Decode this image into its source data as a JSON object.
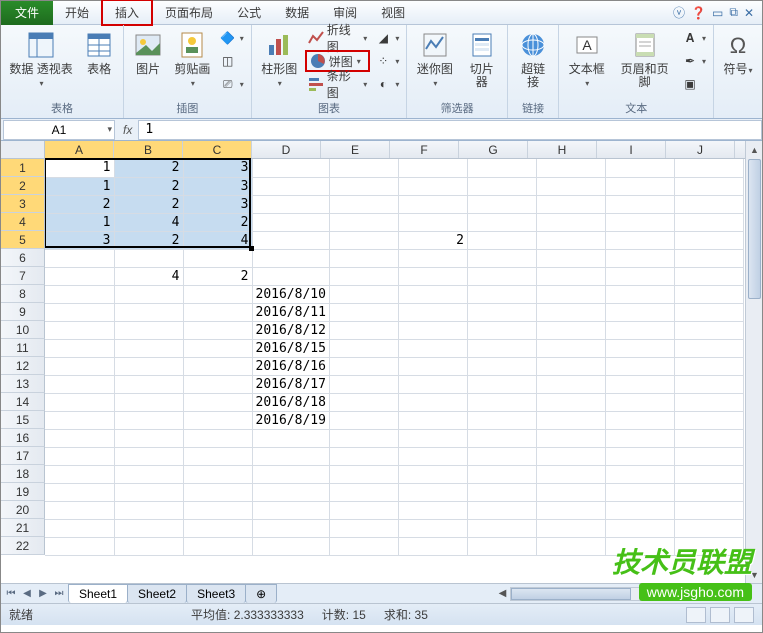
{
  "menu": {
    "file": "文件",
    "tabs": [
      "开始",
      "插入",
      "页面布局",
      "公式",
      "数据",
      "审阅",
      "视图"
    ],
    "active_index": 1
  },
  "ribbon": {
    "groups": {
      "tables": {
        "label": "表格",
        "pivot": "数据\n透视表",
        "table": "表格"
      },
      "illustrations": {
        "label": "插图",
        "picture": "图片",
        "clipart": "剪贴画"
      },
      "charts": {
        "label": "图表",
        "column": "柱形图",
        "line": "折线图",
        "pie": "饼图",
        "bar": "条形图"
      },
      "sparklines": {
        "label": "筛选器",
        "spark": "迷你图",
        "slicer": "切片器"
      },
      "links": {
        "label": "链接",
        "hyper": "超链接"
      },
      "text": {
        "label": "文本",
        "textbox": "文本框",
        "headerfooter": "页眉和页脚"
      },
      "symbols": {
        "label": "",
        "symbol": "符号"
      }
    }
  },
  "formula_bar": {
    "name_box": "A1",
    "fx": "fx",
    "value": "1"
  },
  "columns": [
    "A",
    "B",
    "C",
    "D",
    "E",
    "F",
    "G",
    "H",
    "I",
    "J"
  ],
  "rows_visible": 22,
  "selection": {
    "rows": [
      1,
      2,
      3,
      4,
      5
    ],
    "cols": [
      "A",
      "B",
      "C"
    ]
  },
  "cells": {
    "A1": "1",
    "B1": "2",
    "C1": "3",
    "A2": "1",
    "B2": "2",
    "C2": "3",
    "A3": "2",
    "B3": "2",
    "C3": "3",
    "A4": "1",
    "B4": "4",
    "C4": "2",
    "A5": "3",
    "B5": "2",
    "C5": "4",
    "F5": "2",
    "B7": "4",
    "C7": "2",
    "D8": "2016/8/10",
    "D9": "2016/8/11",
    "D10": "2016/8/12",
    "D11": "2016/8/15",
    "D12": "2016/8/16",
    "D13": "2016/8/17",
    "D14": "2016/8/18",
    "D15": "2016/8/19"
  },
  "sheet_tabs": [
    "Sheet1",
    "Sheet2",
    "Sheet3"
  ],
  "status": {
    "ready": "就绪",
    "avg_label": "平均值:",
    "avg": "2.333333333",
    "count_label": "计数:",
    "count": "15",
    "sum_label": "求和:",
    "sum": "35"
  },
  "watermark": {
    "line1": "技术员联盟",
    "line2": "www.jsgho.com"
  }
}
